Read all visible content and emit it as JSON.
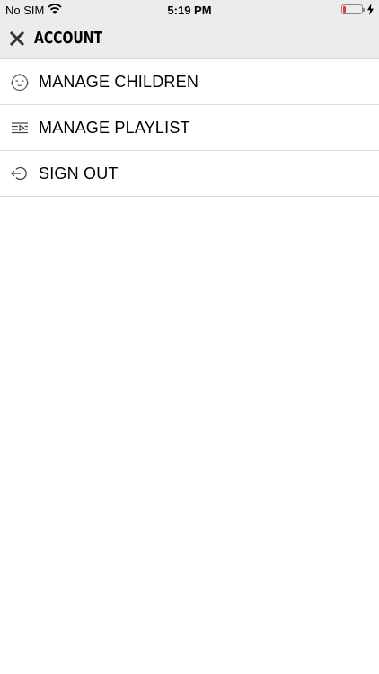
{
  "status_bar": {
    "carrier": "No SIM",
    "time": "5:19 PM",
    "wifi_icon": "wifi-icon",
    "battery_level": 0.15,
    "battery_color": "#e33b2e",
    "charging_icon": "bolt-icon"
  },
  "header": {
    "close_icon": "close-icon",
    "title": "ACCOUNT"
  },
  "menu": {
    "items": [
      {
        "icon": "baby-face-icon",
        "label": "MANAGE CHILDREN"
      },
      {
        "icon": "playlist-icon",
        "label": "MANAGE PLAYLIST"
      },
      {
        "icon": "sign-out-icon",
        "label": "SIGN OUT"
      }
    ]
  }
}
